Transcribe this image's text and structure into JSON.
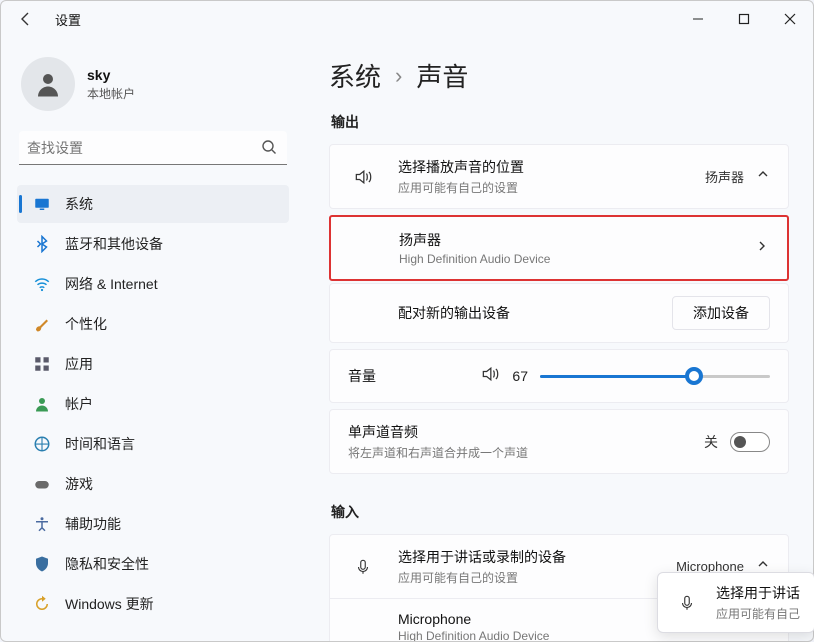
{
  "window": {
    "app_title": "设置"
  },
  "user": {
    "name": "sky",
    "subtitle": "本地帐户"
  },
  "search": {
    "placeholder": "查找设置"
  },
  "nav": {
    "items": [
      {
        "label": "系统",
        "icon": "monitor",
        "color": "#1976d2",
        "active": true
      },
      {
        "label": "蓝牙和其他设备",
        "icon": "bluetooth",
        "color": "#1976d2"
      },
      {
        "label": "网络 & Internet",
        "icon": "wifi",
        "color": "#1790d8"
      },
      {
        "label": "个性化",
        "icon": "brush",
        "color": "#d08828"
      },
      {
        "label": "应用",
        "icon": "apps",
        "color": "#5a5a6a"
      },
      {
        "label": "帐户",
        "icon": "person",
        "color": "#3a9a55"
      },
      {
        "label": "时间和语言",
        "icon": "globe-clock",
        "color": "#2a7fb0"
      },
      {
        "label": "游戏",
        "icon": "gamepad",
        "color": "#6a6a6a"
      },
      {
        "label": "辅助功能",
        "icon": "accessibility",
        "color": "#4a6aa0"
      },
      {
        "label": "隐私和安全性",
        "icon": "shield",
        "color": "#3a6fa0"
      },
      {
        "label": "Windows 更新",
        "icon": "update",
        "color": "#d8a028"
      }
    ]
  },
  "breadcrumb": {
    "root": "系统",
    "leaf": "声音"
  },
  "sections": {
    "output": "输出",
    "input": "输入"
  },
  "output": {
    "choose": {
      "title": "选择播放声音的位置",
      "subtitle": "应用可能有自己的设置",
      "value": "扬声器"
    },
    "device": {
      "title": "扬声器",
      "subtitle": "High Definition Audio Device"
    },
    "pair": {
      "title": "配对新的输出设备",
      "button": "添加设备"
    },
    "volume": {
      "label": "音量",
      "value": 67
    },
    "mono": {
      "title": "单声道音频",
      "subtitle": "将左声道和右声道合并成一个声道",
      "state_label": "关"
    }
  },
  "input": {
    "choose": {
      "title": "选择用于讲话或录制的设备",
      "subtitle": "应用可能有自己的设置",
      "value": "Microphone"
    },
    "device": {
      "title": "Microphone",
      "subtitle": "High Definition Audio Device"
    }
  },
  "popup": {
    "title": "选择用于讲话",
    "subtitle": "应用可能有自己"
  }
}
